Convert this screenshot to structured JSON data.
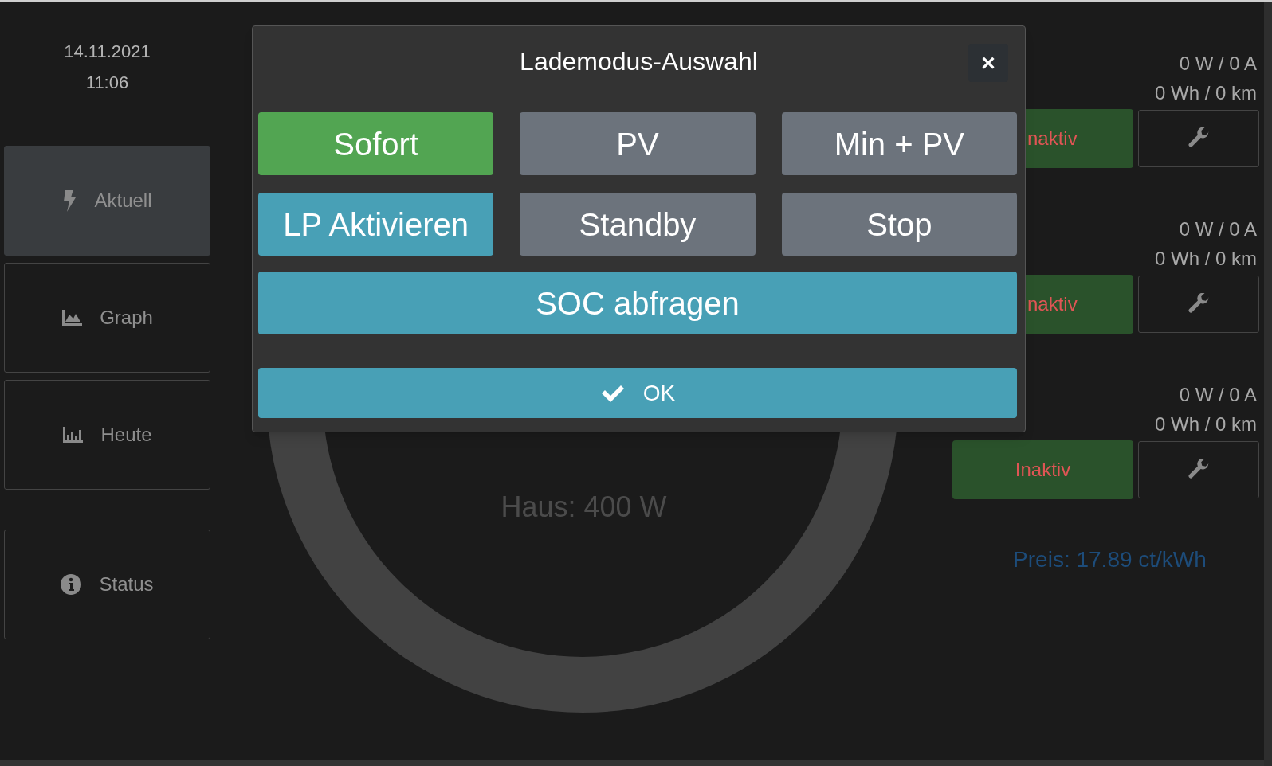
{
  "sidebar": {
    "date": "14.11.2021",
    "time": "11:06",
    "items": [
      {
        "label": "Aktuell",
        "selected": true
      },
      {
        "label": "Graph",
        "selected": false
      },
      {
        "label": "Heute",
        "selected": false
      },
      {
        "label": "Status",
        "selected": false
      }
    ]
  },
  "center": {
    "house_label": "Haus: 400 W"
  },
  "charge_points": [
    {
      "power": "0 W / 0 A",
      "energy": "0 Wh / 0 km",
      "state": "naktiv",
      "partially_hidden": true
    },
    {
      "power": "0 W / 0 A",
      "energy": "0 Wh / 0 km",
      "state": "naktiv",
      "partially_hidden": true
    },
    {
      "power": "0 W / 0 A",
      "energy": "0 Wh / 0 km",
      "state": "Inaktiv",
      "partially_hidden": false
    }
  ],
  "price": "Preis: 17.89 ct/kWh",
  "dialog": {
    "title": "Lademodus-Auswahl",
    "close": "×",
    "buttons": [
      {
        "label": "Sofort",
        "kind": "mode",
        "selected": true
      },
      {
        "label": "PV",
        "kind": "mode",
        "selected": false
      },
      {
        "label": "Min + PV",
        "kind": "mode",
        "selected": false
      },
      {
        "label": "LP Aktivieren",
        "kind": "action"
      },
      {
        "label": "Standby",
        "kind": "mode",
        "selected": false
      },
      {
        "label": "Stop",
        "kind": "mode",
        "selected": false
      }
    ],
    "soc_button": "SOC abfragen",
    "ok_button": "OK"
  }
}
